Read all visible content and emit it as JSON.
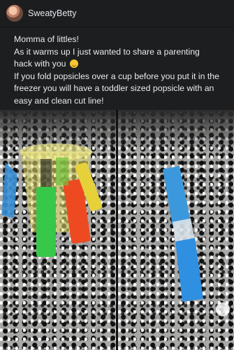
{
  "post": {
    "author": "SweatyBetty",
    "lines": [
      "Momma of littles!",
      "As it warms up I just wanted to share a parenting hack with you",
      "If you fold popsicles over a cup before you put it in the freezer you will have a toddler sized popsicle with an easy and clean cut line!"
    ]
  },
  "media": {
    "photos": [
      "popsicles-folded-over-cup",
      "folded-blue-popsicle-on-counter"
    ]
  },
  "colors": {
    "background": "#18191b",
    "text": "#e4e6eb"
  }
}
